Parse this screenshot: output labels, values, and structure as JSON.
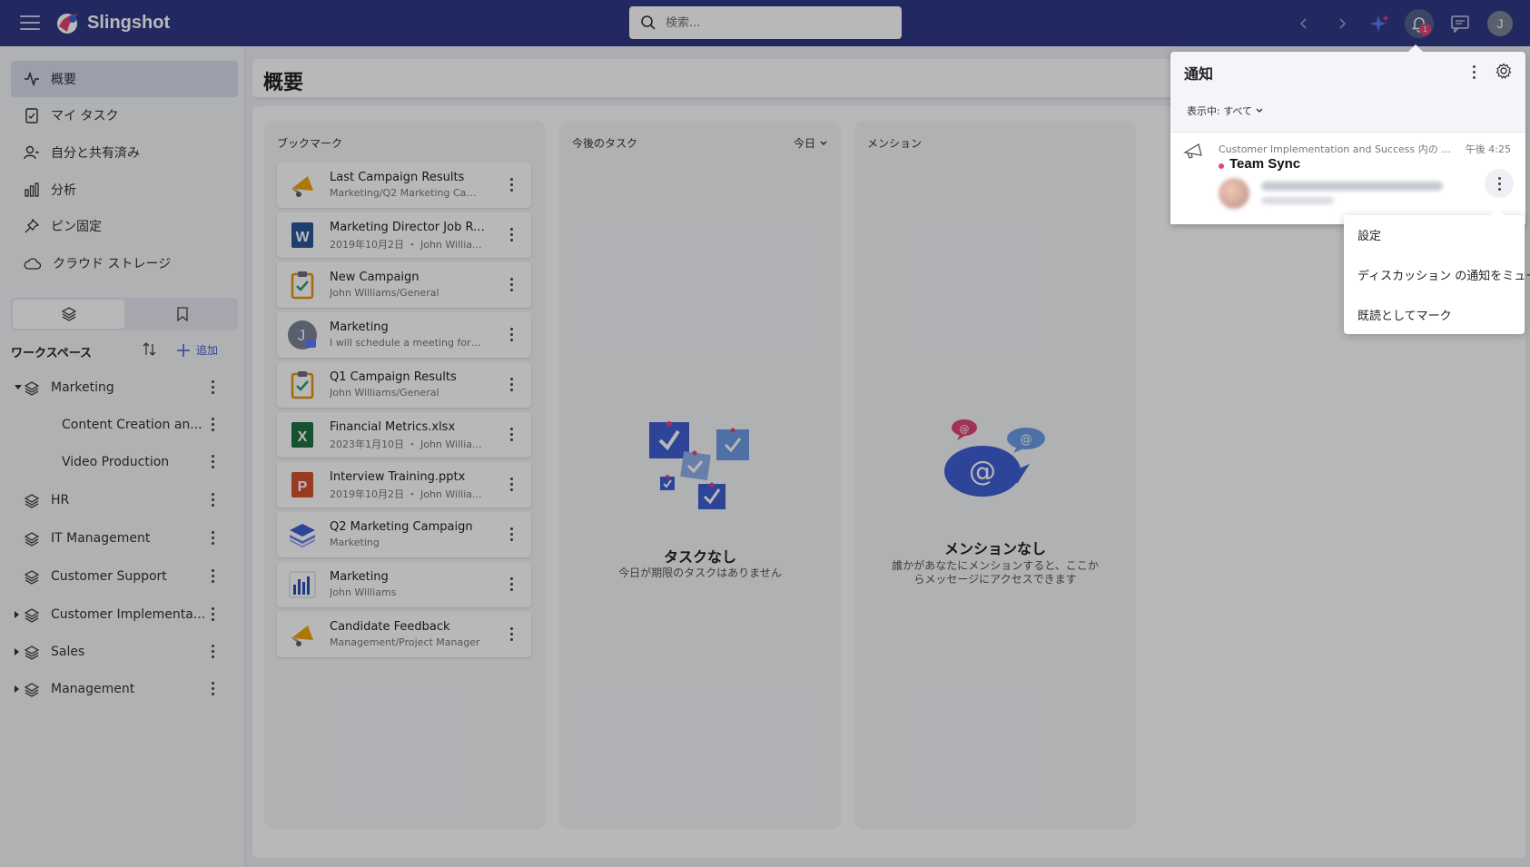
{
  "app": {
    "name": "Slingshot"
  },
  "search": {
    "placeholder": "検索..."
  },
  "topbar": {
    "notification_count": "1",
    "user_initial": "J"
  },
  "sidebar": {
    "nav": [
      {
        "label": "概要",
        "icon": "activity-icon"
      },
      {
        "label": "マイ タスク",
        "icon": "task-icon"
      },
      {
        "label": "自分と共有済み",
        "icon": "shared-user-icon"
      },
      {
        "label": "分析",
        "icon": "bar-chart-icon"
      },
      {
        "label": "ピン固定",
        "icon": "pin-icon"
      },
      {
        "label": "クラウド ストレージ",
        "icon": "cloud-icon"
      }
    ],
    "workspace_title": "ワークスペース",
    "add_label": "追加",
    "workspaces": [
      {
        "label": "Marketing"
      },
      {
        "label": "Content Creation an..."
      },
      {
        "label": "Video Production"
      },
      {
        "label": "HR"
      },
      {
        "label": "IT Management"
      },
      {
        "label": "Customer Support"
      },
      {
        "label": "Customer Implementa..."
      },
      {
        "label": "Sales"
      },
      {
        "label": "Management"
      }
    ]
  },
  "main": {
    "title": "概要",
    "bookmarks": {
      "title": "ブックマーク",
      "items": [
        {
          "name": "Last Campaign Results",
          "sub": "Marketing/Q2 Marketing Cam..."
        },
        {
          "name": "Marketing Director Job Ro...",
          "sub": "2019年10月2日 ・ John Willia..."
        },
        {
          "name": "New Campaign",
          "sub": "John Williams/General"
        },
        {
          "name": "Marketing",
          "sub": "I will schedule a meeting for to..."
        },
        {
          "name": "Q1 Campaign Results",
          "sub": "John Williams/General"
        },
        {
          "name": "Financial Metrics.xlsx",
          "sub": "2023年1月10日 ・ John Willia..."
        },
        {
          "name": "Interview Training.pptx",
          "sub": "2019年10月2日 ・ John Willia..."
        },
        {
          "name": "Q2 Marketing Campaign",
          "sub": "Marketing"
        },
        {
          "name": "Marketing",
          "sub": "John Williams"
        },
        {
          "name": "Candidate Feedback",
          "sub": "Management/Project Manager"
        }
      ]
    },
    "tasks": {
      "title": "今後のタスク",
      "filter": "今日",
      "empty_title": "タスクなし",
      "empty_text": "今日が期限のタスクはありません"
    },
    "mentions": {
      "title": "メンション",
      "empty_title": "メンションなし",
      "empty_text_1": "誰かがあなたにメンションすると、ここか",
      "empty_text_2": "らメッセージにアクセスできます"
    }
  },
  "notifications": {
    "title": "通知",
    "filter": "表示中: すべて",
    "item": {
      "source": "Customer Implementation and Success 内の ディ...",
      "time": "午後 4:25",
      "title": "Team Sync"
    }
  },
  "menu": {
    "items": [
      "設定",
      "ディスカッション の通知をミュート",
      "既読としてマーク"
    ]
  },
  "colors": {
    "topbar": "#2f3a86",
    "accent": "#3f5fd4",
    "badge": "#e24577"
  }
}
